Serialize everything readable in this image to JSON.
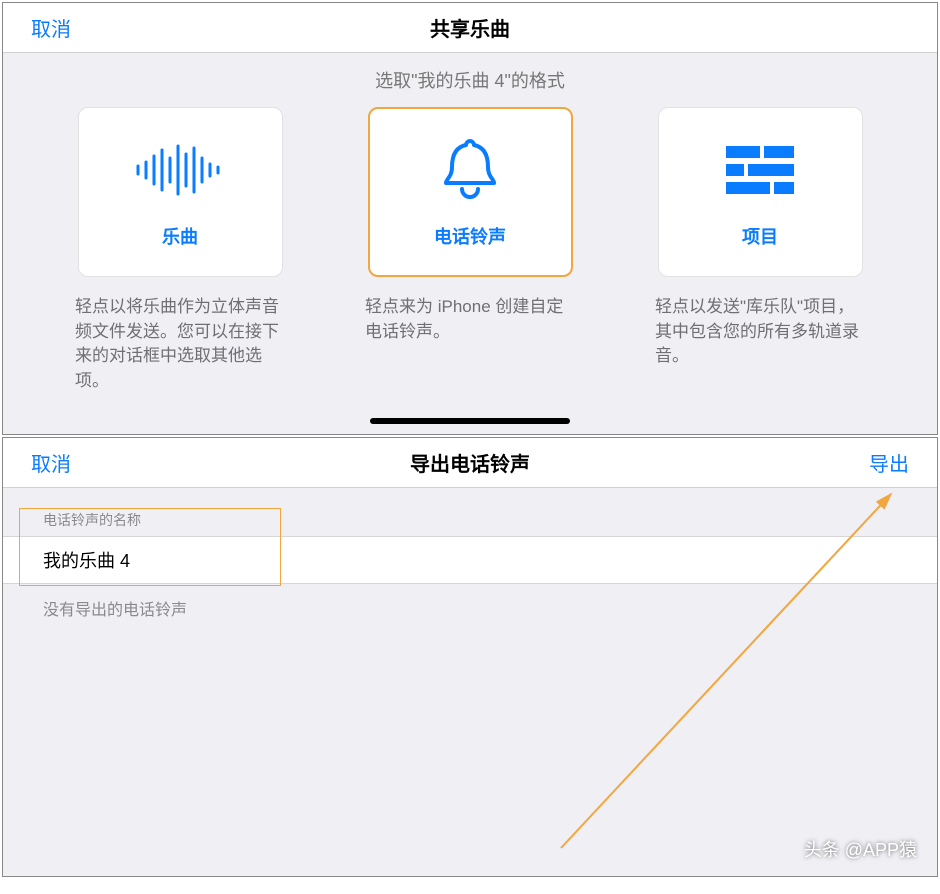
{
  "panel1": {
    "cancel": "取消",
    "title": "共享乐曲",
    "subtitle": "选取\"我的乐曲 4\"的格式",
    "options": [
      {
        "key": "song",
        "label": "乐曲",
        "desc": "轻点以将乐曲作为立体声音频文件发送。您可以在接下来的对话框中选取其他选项。",
        "selected": false
      },
      {
        "key": "ringtone",
        "label": "电话铃声",
        "desc": "轻点来为 iPhone 创建自定电话铃声。",
        "selected": true
      },
      {
        "key": "project",
        "label": "项目",
        "desc": "轻点以发送\"库乐队\"项目，其中包含您的所有多轨道录音。",
        "selected": false
      }
    ]
  },
  "panel2": {
    "cancel": "取消",
    "title": "导出电话铃声",
    "action": "导出",
    "field_label": "电话铃声的名称",
    "field_value": "我的乐曲 4",
    "footer": "没有导出的电话铃声"
  },
  "watermark": "头条 @APP猿"
}
